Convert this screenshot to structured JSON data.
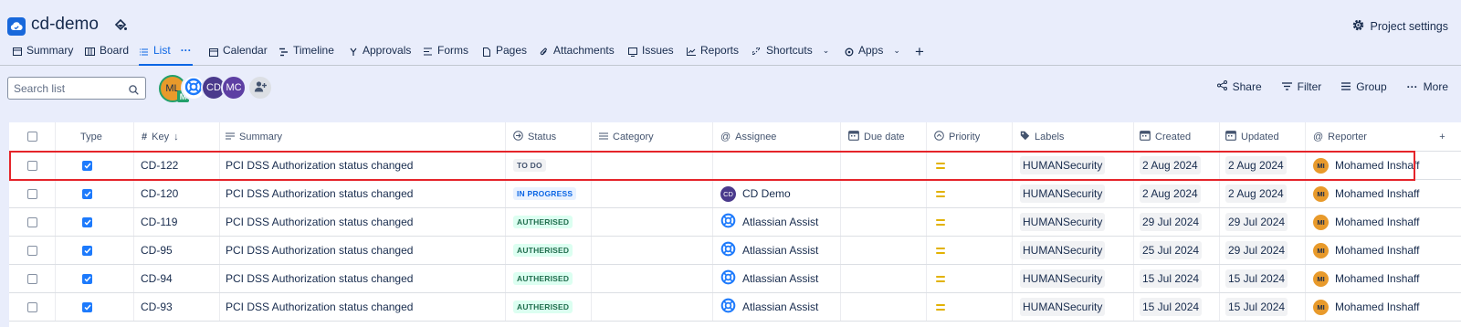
{
  "project": {
    "title": "cd-demo",
    "settings_label": "Project settings"
  },
  "tabs": [
    {
      "label": "Summary",
      "icon": "summary-icon"
    },
    {
      "label": "Board",
      "icon": "board-icon"
    },
    {
      "label": "List",
      "icon": "list-icon",
      "active": true
    },
    {
      "label": "Calendar",
      "icon": "calendar-icon"
    },
    {
      "label": "Timeline",
      "icon": "timeline-icon"
    },
    {
      "label": "Approvals",
      "icon": "approvals-icon"
    },
    {
      "label": "Forms",
      "icon": "forms-icon"
    },
    {
      "label": "Pages",
      "icon": "pages-icon"
    },
    {
      "label": "Attachments",
      "icon": "attachment-icon"
    },
    {
      "label": "Issues",
      "icon": "issues-icon"
    },
    {
      "label": "Reports",
      "icon": "reports-icon"
    },
    {
      "label": "Shortcuts",
      "icon": "link-icon"
    },
    {
      "label": "Apps",
      "icon": "apps-icon"
    }
  ],
  "list_more": "···",
  "search": {
    "placeholder": "Search list"
  },
  "avatars": {
    "ml": "ML",
    "m": "M",
    "cd": "CD",
    "mc": "MC"
  },
  "actions": {
    "share": "Share",
    "filter": "Filter",
    "group": "Group",
    "more": "More"
  },
  "columns": {
    "type": "Type",
    "key": "Key",
    "summary": "Summary",
    "status": "Status",
    "category": "Category",
    "assignee": "Assignee",
    "due_date": "Due date",
    "priority": "Priority",
    "labels": "Labels",
    "created": "Created",
    "updated": "Updated",
    "reporter": "Reporter"
  },
  "rows": [
    {
      "key": "CD-122",
      "summary": "PCI DSS Authorization status changed",
      "status": "TO DO",
      "status_kind": "todo",
      "assignee": "",
      "label": "HUMANSecurity",
      "created": "2 Aug 2024",
      "updated": "2 Aug 2024",
      "reporter": "Mohamed Inshaff",
      "reporter_initials": "MI"
    },
    {
      "key": "CD-120",
      "summary": "PCI DSS Authorization status changed",
      "status": "IN PROGRESS",
      "status_kind": "prog",
      "assignee": "CD Demo",
      "assignee_initials": "CD",
      "label": "HUMANSecurity",
      "created": "2 Aug 2024",
      "updated": "2 Aug 2024",
      "reporter": "Mohamed Inshaff",
      "reporter_initials": "MI"
    },
    {
      "key": "CD-119",
      "summary": "PCI DSS Authorization status changed",
      "status": "AUTHERISED",
      "status_kind": "auth",
      "assignee": "Atlassian Assist",
      "label": "HUMANSecurity",
      "created": "29 Jul 2024",
      "updated": "29 Jul 2024",
      "reporter": "Mohamed Inshaff",
      "reporter_initials": "MI"
    },
    {
      "key": "CD-95",
      "summary": "PCI DSS Authorization status changed",
      "status": "AUTHERISED",
      "status_kind": "auth",
      "assignee": "Atlassian Assist",
      "label": "HUMANSecurity",
      "created": "25 Jul 2024",
      "updated": "29 Jul 2024",
      "reporter": "Mohamed Inshaff",
      "reporter_initials": "MI"
    },
    {
      "key": "CD-94",
      "summary": "PCI DSS Authorization status changed",
      "status": "AUTHERISED",
      "status_kind": "auth",
      "assignee": "Atlassian Assist",
      "label": "HUMANSecurity",
      "created": "15 Jul 2024",
      "updated": "15 Jul 2024",
      "reporter": "Mohamed Inshaff",
      "reporter_initials": "MI"
    },
    {
      "key": "CD-93",
      "summary": "PCI DSS Authorization status changed",
      "status": "AUTHERISED",
      "status_kind": "auth",
      "assignee": "Atlassian Assist",
      "label": "HUMANSecurity",
      "created": "15 Jul 2024",
      "updated": "15 Jul 2024",
      "reporter": "Mohamed Inshaff",
      "reporter_initials": "MI"
    }
  ],
  "colors": {
    "accent": "#0C66E4",
    "background": "#E9EDFB",
    "highlight": "#E5242A"
  }
}
